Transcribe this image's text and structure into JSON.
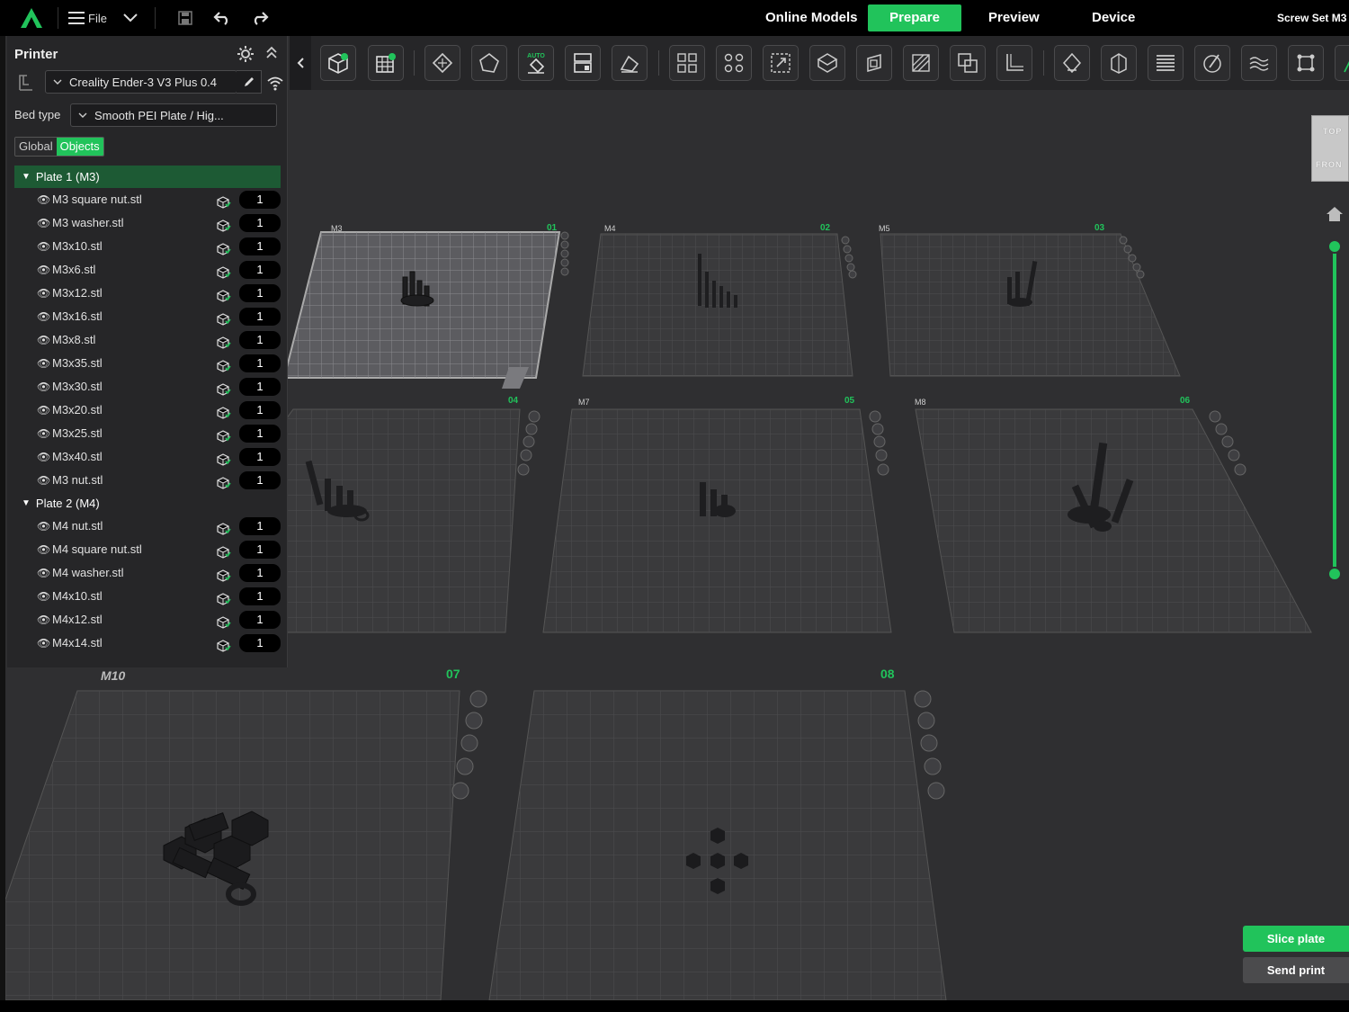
{
  "menu": {
    "file_label": "File"
  },
  "nav": {
    "tabs": [
      {
        "label": "Online Models",
        "active": false
      },
      {
        "label": "Prepare",
        "active": true
      },
      {
        "label": "Preview",
        "active": false
      },
      {
        "label": "Device",
        "active": false
      }
    ],
    "project_title": "Screw Set M3"
  },
  "colors": {
    "accent": "#21c35b",
    "background": "#2f2f31",
    "panel": "#262628"
  },
  "toolbar": {
    "auto_badge": "AUTO",
    "tools": [
      "add-object-icon",
      "add-plate-icon",
      "orient-icon",
      "lay-on-face-icon",
      "auto-arrange-icon",
      "arrange-plate-icon",
      "plate-settings-icon",
      "split-objects-icon",
      "split-parts-icon",
      "scale-icon",
      "shell-icon",
      "hollow-icon",
      "cut-icon",
      "boolean-icon",
      "measure-icon",
      "support-paint-icon",
      "seam-paint-icon",
      "layer-height-icon",
      "color-paint-icon",
      "text-emboss-icon",
      "assembly-icon",
      "more-icon"
    ]
  },
  "panel": {
    "title": "Printer",
    "printer_name": "Creality Ender-3 V3 Plus 0.4",
    "bed_type_label": "Bed type",
    "bed_type_value": "Smooth PEI Plate / Hig...",
    "seg_global": "Global",
    "seg_objects": "Objects",
    "plates": [
      {
        "label": "Plate 1 (M3)",
        "objects": [
          {
            "name": "M3 square nut.stl",
            "count": "1"
          },
          {
            "name": "M3 washer.stl",
            "count": "1"
          },
          {
            "name": "M3x10.stl",
            "count": "1"
          },
          {
            "name": "M3x6.stl",
            "count": "1"
          },
          {
            "name": "M3x12.stl",
            "count": "1"
          },
          {
            "name": "M3x16.stl",
            "count": "1"
          },
          {
            "name": "M3x8.stl",
            "count": "1"
          },
          {
            "name": "M3x35.stl",
            "count": "1"
          },
          {
            "name": "M3x30.stl",
            "count": "1"
          },
          {
            "name": "M3x20.stl",
            "count": "1"
          },
          {
            "name": "M3x25.stl",
            "count": "1"
          },
          {
            "name": "M3x40.stl",
            "count": "1"
          },
          {
            "name": "M3 nut.stl",
            "count": "1"
          }
        ]
      },
      {
        "label": "Plate 2 (M4)",
        "objects": [
          {
            "name": "M4 nut.stl",
            "count": "1"
          },
          {
            "name": "M4 square nut.stl",
            "count": "1"
          },
          {
            "name": "M4 washer.stl",
            "count": "1"
          },
          {
            "name": "M4x10.stl",
            "count": "1"
          },
          {
            "name": "M4x12.stl",
            "count": "1"
          },
          {
            "name": "M4x14.stl",
            "count": "1"
          }
        ]
      }
    ]
  },
  "viewport": {
    "plates": [
      {
        "name": "M3",
        "number": "01"
      },
      {
        "name": "M4",
        "number": "02"
      },
      {
        "name": "M5",
        "number": "03"
      },
      {
        "name": "",
        "number": "04"
      },
      {
        "name": "M7",
        "number": "05"
      },
      {
        "name": "M8",
        "number": "06"
      },
      {
        "name": "M10",
        "number": "07"
      },
      {
        "name": "",
        "number": "08"
      }
    ],
    "viewcube_top": "TOP",
    "viewcube_front": "FRON"
  },
  "actions": {
    "slice": "Slice plate",
    "send": "Send print"
  }
}
